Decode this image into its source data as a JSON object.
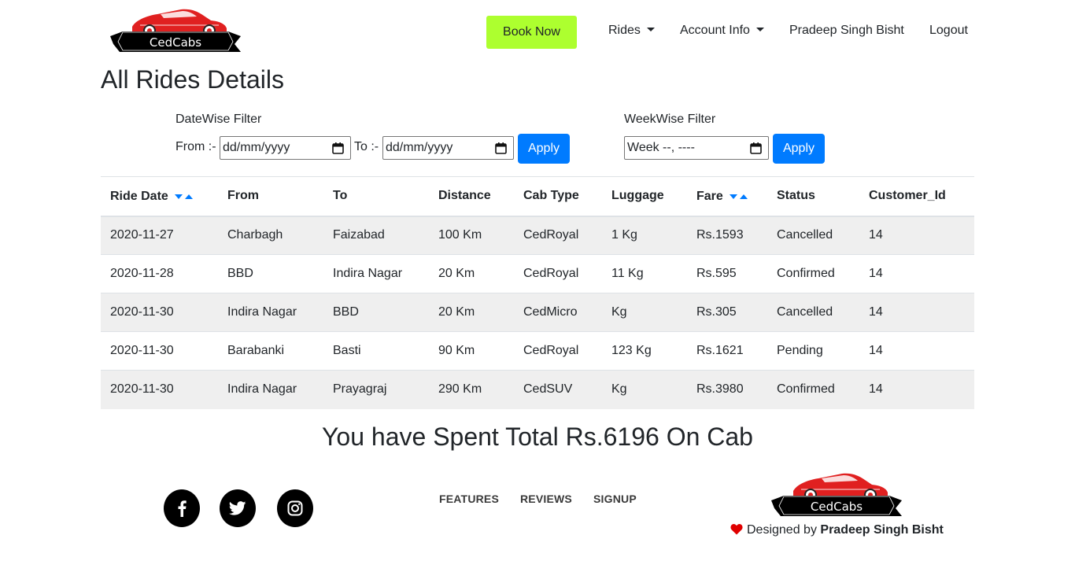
{
  "navbar": {
    "brand_name": "CedCabs",
    "book_now": "Book Now",
    "rides_label": "Rides",
    "account_label": "Account Info",
    "user_name": "Pradeep Singh Bisht",
    "logout_label": "Logout"
  },
  "page": {
    "title": "All Rides Details"
  },
  "filters": {
    "datewise_title": "DateWise Filter",
    "from_label": "From :-",
    "to_label": "To :-",
    "from_value": "dd/mm/yyyy",
    "to_value": "dd/mm/yyyy",
    "weekwise_title": "WeekWise Filter",
    "week_value": "Week --, ----",
    "apply_label": "Apply"
  },
  "table": {
    "columns": [
      "Ride Date",
      "From",
      "To",
      "Distance",
      "Cab Type",
      "Luggage",
      "Fare",
      "Status",
      "Customer_Id"
    ],
    "rows": [
      [
        "2020-11-27",
        "Charbagh",
        "Faizabad",
        "100 Km",
        "CedRoyal",
        "1 Kg",
        "Rs.1593",
        "Cancelled",
        "14"
      ],
      [
        "2020-11-28",
        "BBD",
        "Indira Nagar",
        "20 Km",
        "CedRoyal",
        "11 Kg",
        "Rs.595",
        "Confirmed",
        "14"
      ],
      [
        "2020-11-30",
        "Indira Nagar",
        "BBD",
        "20 Km",
        "CedMicro",
        "Kg",
        "Rs.305",
        "Cancelled",
        "14"
      ],
      [
        "2020-11-30",
        "Barabanki",
        "Basti",
        "90 Km",
        "CedRoyal",
        "123 Kg",
        "Rs.1621",
        "Pending",
        "14"
      ],
      [
        "2020-11-30",
        "Indira Nagar",
        "Prayagraj",
        "290 Km",
        "CedSUV",
        "Kg",
        "Rs.3980",
        "Confirmed",
        "14"
      ]
    ]
  },
  "summary": {
    "total_text": "You have Spent Total Rs.6196 On Cab"
  },
  "footer": {
    "socials": [
      "facebook-icon",
      "twitter-icon",
      "instagram-icon"
    ],
    "links": [
      "FEATURES",
      "REVIEWS",
      "SIGNUP"
    ],
    "brand_name": "CedCabs",
    "designed_prefix": "Designed by",
    "designer_name": "Pradeep Singh Bisht"
  },
  "colors": {
    "book_now_bg": "#adff2f",
    "primary": "#007bff",
    "striped_row": "#efefef",
    "heart": "#e00000",
    "car_red": "#e02020"
  }
}
